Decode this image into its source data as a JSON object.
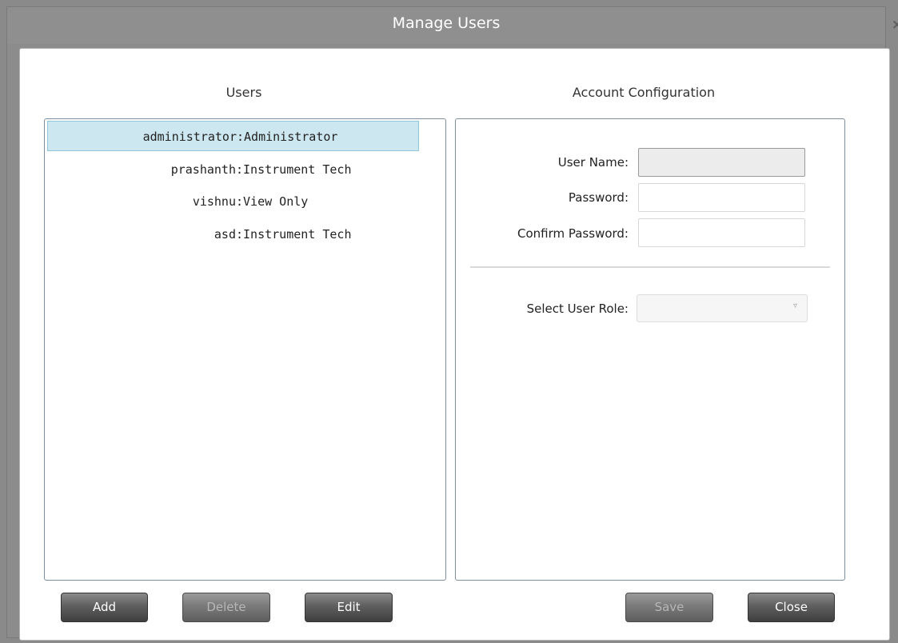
{
  "dialog": {
    "title": "Manage Users",
    "close_glyph": "×"
  },
  "users_section": {
    "heading": "Users",
    "items": [
      {
        "name": "administrator",
        "separator": ":",
        "role": "Administrator",
        "selected": true
      },
      {
        "name": "prashanth",
        "separator": ":",
        "role": "Instrument Tech",
        "selected": false
      },
      {
        "name": "vishnu",
        "separator": ":",
        "role": "View Only",
        "selected": false
      },
      {
        "name": "asd",
        "separator": ":",
        "role": "Instrument Tech",
        "selected": false
      }
    ]
  },
  "account_section": {
    "heading": "Account Configuration",
    "user_name_label": "User Name:",
    "user_name_value": "",
    "password_label": "Password:",
    "password_value": "",
    "confirm_password_label": "Confirm Password:",
    "confirm_password_value": "",
    "role_label": "Select User Role:",
    "role_value": "",
    "role_arrow_glyph": "▿"
  },
  "buttons": {
    "add": "Add",
    "delete": "Delete",
    "edit": "Edit",
    "save": "Save",
    "close": "Close"
  },
  "colors": {
    "selection": "#cde7f0",
    "frame": "#8c8c8c"
  }
}
